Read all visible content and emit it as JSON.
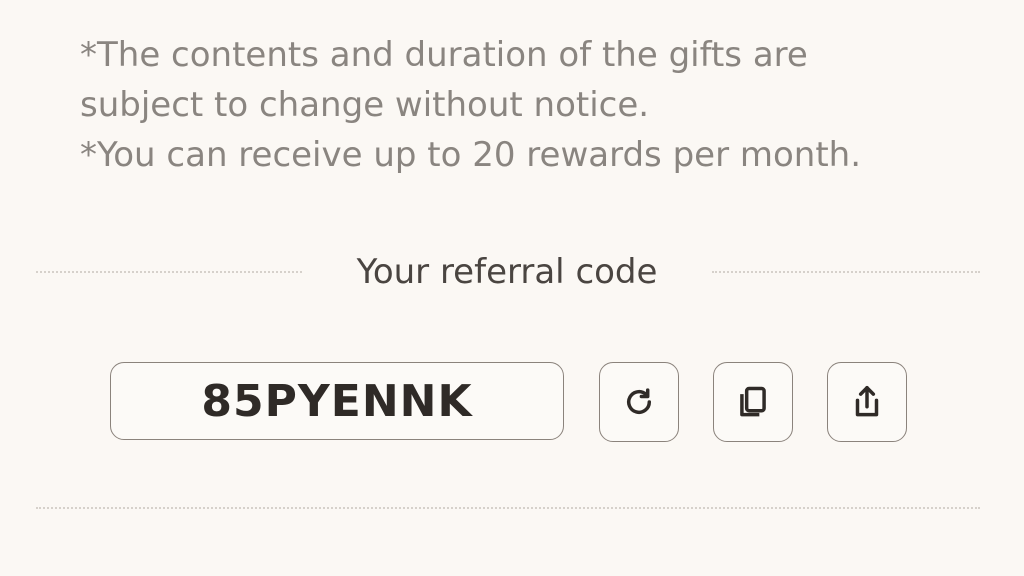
{
  "notes": [
    "*The contents and duration of the gifts are",
    "subject to change without notice.",
    "*You can receive up to 20 rewards per month."
  ],
  "referral": {
    "title": "Your referral code",
    "code": "85PYENNK"
  },
  "actions": {
    "refresh_icon": "refresh-icon",
    "copy_icon": "copy-icon",
    "share_icon": "share-icon"
  }
}
